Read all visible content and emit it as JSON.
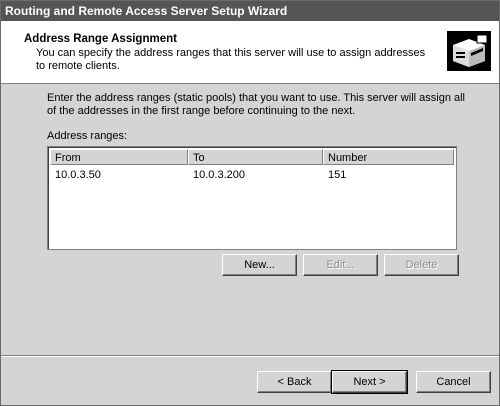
{
  "window": {
    "title": "Routing and Remote Access Server Setup Wizard"
  },
  "header": {
    "title": "Address Range Assignment",
    "description": "You can specify the address ranges that this server will use to assign addresses to remote clients."
  },
  "body": {
    "instructions": "Enter the address ranges (static pools) that you want to use. This server will assign all of the addresses in the first range before continuing to the next.",
    "ranges_label": "Address ranges:"
  },
  "table": {
    "columns": [
      "From",
      "To",
      "Number"
    ],
    "rows": [
      {
        "from": "10.0.3.50",
        "to": "10.0.3.200",
        "number": "151"
      }
    ]
  },
  "buttons": {
    "new": "New...",
    "edit": "Edit...",
    "delete": "Delete",
    "back": "< Back",
    "next": "Next >",
    "cancel": "Cancel"
  }
}
